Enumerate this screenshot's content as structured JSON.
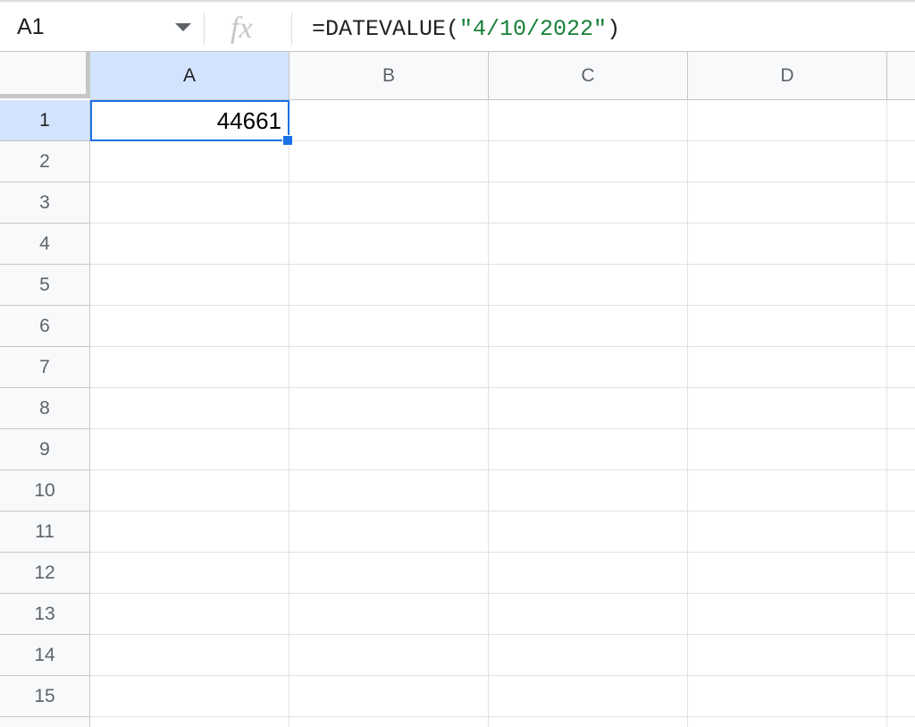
{
  "formula_bar": {
    "name_box": "A1",
    "fx_label": "fx",
    "formula_prefix": "=DATEVALUE(",
    "formula_string": "\"4/10/2022\"",
    "formula_suffix": ")"
  },
  "sheet": {
    "columns": [
      "A",
      "B",
      "C",
      "D"
    ],
    "rows": [
      "1",
      "2",
      "3",
      "4",
      "5",
      "6",
      "7",
      "8",
      "9",
      "10",
      "11",
      "12",
      "13",
      "14",
      "15"
    ],
    "cells": {
      "A1": "44661"
    },
    "selected_cell": "A1"
  },
  "colors": {
    "selection": "#1a73e8",
    "header_selected": "#d3e3fd",
    "formula_string": "#188038"
  }
}
